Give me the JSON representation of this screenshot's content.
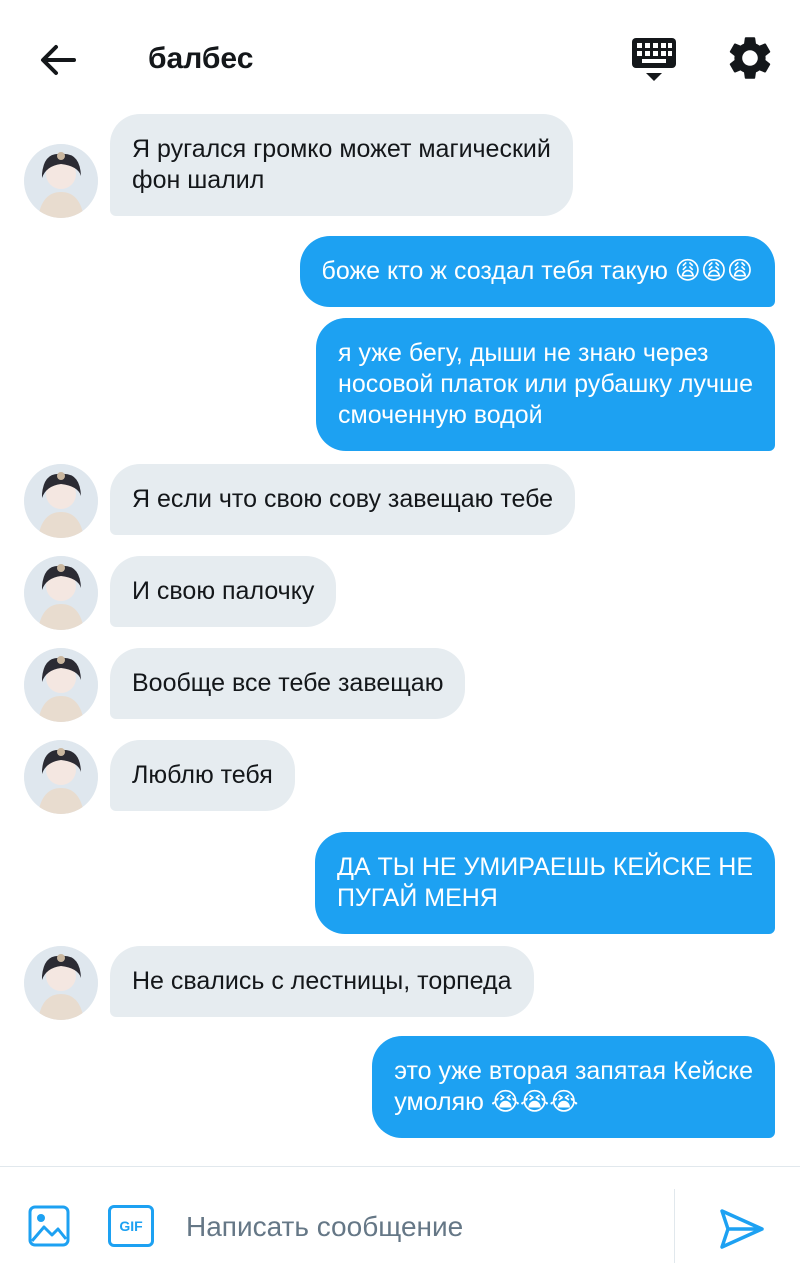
{
  "header": {
    "title": "балбес",
    "icons": {
      "back": "arrow-left-icon",
      "keyboard": "keyboard-icon",
      "settings": "gear-icon"
    }
  },
  "messages": [
    {
      "direction": "in",
      "text": "Я ругался громко может магический\nфон шалил"
    },
    {
      "direction": "out",
      "text": "боже кто ж создал тебя такую 😩😩😩"
    },
    {
      "direction": "out",
      "text": "я уже бегу, дыши не знаю через\nносовой платок или рубашку лучше\nсмоченную водой"
    },
    {
      "direction": "in",
      "text": "Я если что свою сову завещаю тебе"
    },
    {
      "direction": "in",
      "text": "И свою палочку"
    },
    {
      "direction": "in",
      "text": "Вообще все тебе завещаю"
    },
    {
      "direction": "in",
      "text": "Люблю тебя"
    },
    {
      "direction": "out",
      "text": "ДА ТЫ НЕ УМИРАЕШЬ КЕЙСКЕ НЕ\nПУГАЙ МЕНЯ"
    },
    {
      "direction": "in",
      "text": "Не свались с лестницы, торпеда"
    },
    {
      "direction": "out",
      "text": "это уже вторая запятая Кейске\nумоляю 😭😭😭"
    }
  ],
  "composer": {
    "placeholder": "Написать сообщение",
    "value": "",
    "gif_label": "GIF",
    "icons": {
      "image": "image-icon",
      "send": "send-icon"
    }
  },
  "colors": {
    "accent": "#1da1f2",
    "incoming_bubble": "#e6ecf0",
    "text": "#14171a",
    "muted": "#657786"
  }
}
